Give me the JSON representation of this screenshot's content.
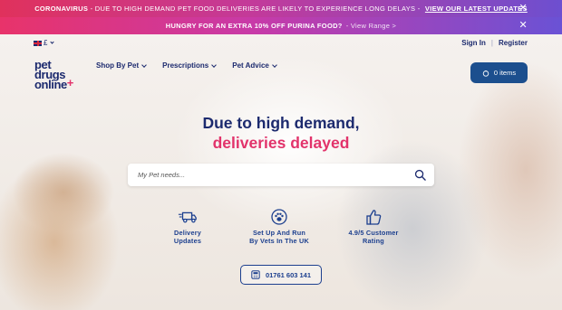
{
  "banners": {
    "first": {
      "highlight": "CORONAVIRUS",
      "text": " - DUE TO HIGH DEMAND PET FOOD DELIVERIES ARE LIKELY TO EXPERIENCE LONG DELAYS - ",
      "link": "VIEW OUR LATEST UPDATES",
      "close": "✕"
    },
    "second": {
      "highlight": "HUNGRY FOR AN EXTRA 10% OFF PURINA FOOD?",
      "link": "- View Range >",
      "close": "✕"
    }
  },
  "topbar": {
    "currency": "£",
    "sign_in": "Sign In",
    "separator": "|",
    "register": "Register"
  },
  "logo": {
    "line1": "pet",
    "line2": "drugs",
    "line3": "online",
    "plus": "+"
  },
  "nav": {
    "items": [
      {
        "label": "Shop By Pet"
      },
      {
        "label": "Prescriptions"
      },
      {
        "label": "Pet Advice"
      }
    ]
  },
  "basket": {
    "label": "0 items"
  },
  "hero": {
    "headline_line1": "Due to high demand,",
    "headline_line2": "deliveries delayed"
  },
  "search": {
    "placeholder": "My Pet needs..."
  },
  "features": [
    {
      "line1": "Delivery",
      "line2": "Updates",
      "icon": "delivery-truck-icon"
    },
    {
      "line1": "Set Up And Run",
      "line2": "By Vets In The UK",
      "icon": "paw-icon"
    },
    {
      "line1": "4.9/5 Customer",
      "line2": "Rating",
      "icon": "thumbs-up-icon"
    }
  ],
  "phone": {
    "number": "01761 603 141"
  },
  "colors": {
    "navy": "#1c2a6e",
    "pink": "#e2336b",
    "basket_blue": "#1c4f8e"
  }
}
